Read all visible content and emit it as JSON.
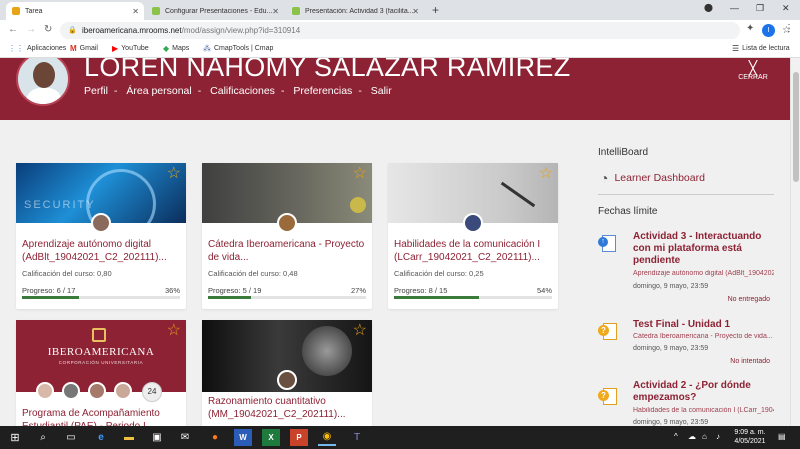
{
  "browser": {
    "tabs": [
      {
        "title": "Tarea",
        "active": true,
        "fav_color": "#e8a317"
      },
      {
        "title": "Configurar Presentaciones - Edu...",
        "active": false,
        "fav_color": "#8bc34a"
      },
      {
        "title": "Presentación: Actividad 3 (facilita...",
        "active": false,
        "fav_color": "#8bc34a"
      }
    ],
    "url_host": "iberoamericana.mrooms.net",
    "url_path": "/mod/assign/view.php?id=310914",
    "profile_initial": "I",
    "bookmarks": [
      "Aplicaciones",
      "Gmail",
      "YouTube",
      "Maps",
      "CmapTools | Cmap"
    ],
    "reading_list": "Lista de lectura"
  },
  "user": {
    "name": "LOREN NAHOMY SALAZAR RAMIREZ",
    "menu": [
      "Perfil",
      "Área personal",
      "Calificaciones",
      "Preferencias",
      "Salir"
    ],
    "close_label": "CERRAR"
  },
  "courses": [
    {
      "title": "Aprendizaje autónomo digital (AdBlt_19042021_C2_202111)...",
      "grade": "Calificación del curso: 0,80",
      "progress": "Progreso: 6 / 17",
      "pct": "36%",
      "fraction": 0.36
    },
    {
      "title": "Cátedra Iberoamericana - Proyecto de vida...",
      "grade": "Calificación del curso: 0,48",
      "progress": "Progreso: 5 / 19",
      "pct": "27%",
      "fraction": 0.27
    },
    {
      "title": "Habilidades de la comunicación I (LCarr_19042021_C2_202111)...",
      "grade": "Calificación del curso: 0,25",
      "progress": "Progreso: 8 / 15",
      "pct": "54%",
      "fraction": 0.54
    },
    {
      "title": "Programa de Acompañamiento Estudiantil (PAE) - Periodo I...",
      "banner_text": "IBEROAMERICANA",
      "banner_sub": "CORPORACIÓN UNIVERSITARIA",
      "extra_count": "24"
    },
    {
      "title": "Razonamiento cuantitativo (MM_19042021_C2_202111)..."
    }
  ],
  "sidebar": {
    "intelliboard": "IntelliBoard",
    "learner_dashboard": "Learner Dashboard",
    "deadlines_heading": "Fechas límite",
    "deadlines": [
      {
        "title": "Actividad 3 - Interactuando con mi plataforma está pendiente",
        "course": "Aprendizaje autónomo digital (AdBlt_19042021_C2...",
        "date": "domingo, 9 mayo, 23:59",
        "status": "No entregado",
        "icon": "assignment-icon"
      },
      {
        "title": "Test Final - Unidad 1",
        "course": "Cátedra Iberoamericana - Proyecto de vida...",
        "date": "domingo, 9 mayo, 23:59",
        "status": "No intentado",
        "icon": "quiz-icon"
      },
      {
        "title": "Actividad 2 - ¿Por dónde empezamos?",
        "course": "Habilidades de la comunicación I (LCarr_1904...",
        "date": "domingo, 9 mayo, 23:59",
        "status": "",
        "icon": "quiz-icon"
      }
    ]
  },
  "taskbar": {
    "time": "9:09 a. m.",
    "date": "4/05/2021"
  }
}
